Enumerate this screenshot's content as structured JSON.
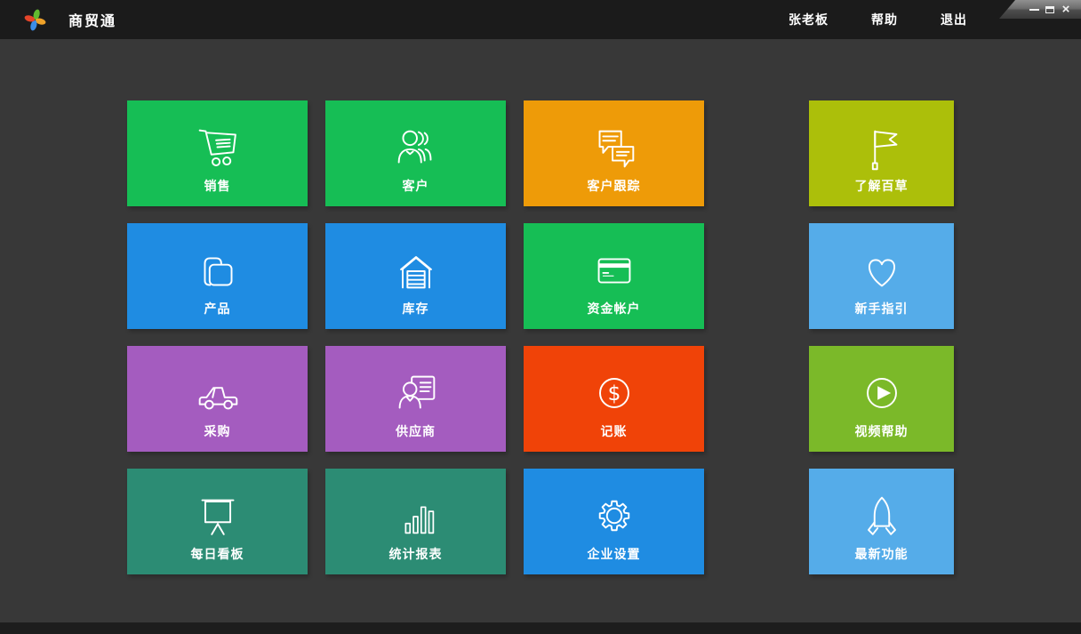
{
  "window": {
    "title": "商贸通",
    "controls": {
      "close_glyph": "×"
    }
  },
  "topbar": {
    "user": "张老板",
    "help": "帮助",
    "exit": "退出"
  },
  "colors": {
    "topbar_bg": "#1b1b1b",
    "body_bg": "#383838",
    "green": "#16be55",
    "orange": "#ee9b08",
    "blue": "#1f8ce2",
    "light_blue": "#55ace9",
    "purple": "#a45cbf",
    "red_orange": "#f04308",
    "yellow_green": "#acbf0a",
    "apple_green": "#7bb929",
    "teal": "#2c8c74"
  },
  "tiles": {
    "main": [
      {
        "name": "sales",
        "label": "销售",
        "icon": "cart-icon",
        "color": "#16be55"
      },
      {
        "name": "customers",
        "label": "客户",
        "icon": "people-icon",
        "color": "#16be55"
      },
      {
        "name": "customer-tracking",
        "label": "客户跟踪",
        "icon": "chat-icon",
        "color": "#ee9b08"
      },
      {
        "name": "products",
        "label": "产品",
        "icon": "folder-icon",
        "color": "#1f8ce2"
      },
      {
        "name": "inventory",
        "label": "库存",
        "icon": "warehouse-icon",
        "color": "#1f8ce2"
      },
      {
        "name": "fund-account",
        "label": "资金帐户",
        "icon": "credit-card-icon",
        "color": "#16be55"
      },
      {
        "name": "purchasing",
        "label": "采购",
        "icon": "car-icon",
        "color": "#a45cbf"
      },
      {
        "name": "suppliers",
        "label": "供应商",
        "icon": "supplier-card-icon",
        "color": "#a45cbf"
      },
      {
        "name": "bookkeeping",
        "label": "记账",
        "icon": "dollar-circle-icon",
        "color": "#f04308"
      },
      {
        "name": "daily-board",
        "label": "每日看板",
        "icon": "presentation-board-icon",
        "color": "#2c8c74"
      },
      {
        "name": "statistics-reports",
        "label": "统计报表",
        "icon": "bar-chart-icon",
        "color": "#2c8c74"
      },
      {
        "name": "enterprise-settings",
        "label": "企业设置",
        "icon": "gear-icon",
        "color": "#1f8ce2"
      }
    ],
    "side": [
      {
        "name": "about-baicao",
        "label": "了解百草",
        "icon": "flag-icon",
        "color": "#acbf0a"
      },
      {
        "name": "beginner-guide",
        "label": "新手指引",
        "icon": "heart-icon",
        "color": "#55ace9"
      },
      {
        "name": "video-help",
        "label": "视频帮助",
        "icon": "play-circle-icon",
        "color": "#7bb929"
      },
      {
        "name": "latest-features",
        "label": "最新功能",
        "icon": "rocket-icon",
        "color": "#55ace9"
      }
    ]
  }
}
